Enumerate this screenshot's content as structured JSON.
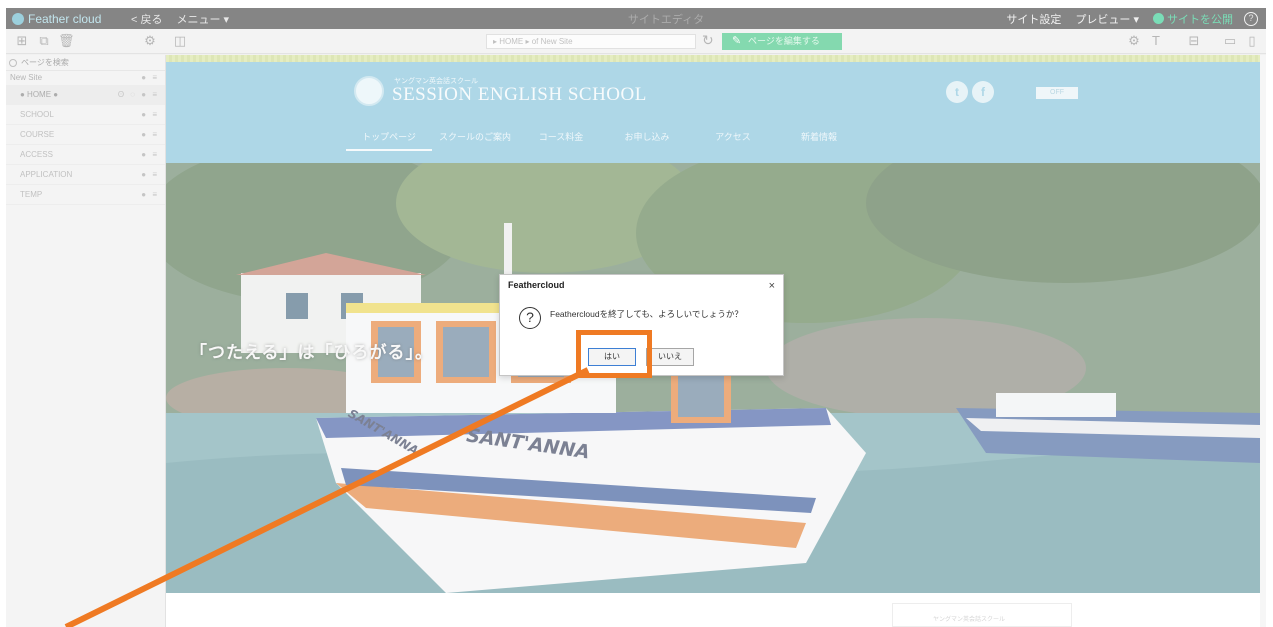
{
  "topbar": {
    "brand": "Feather cloud",
    "back": "< 戻る",
    "menu": "メニュー ▾",
    "center_title": "サイトエディタ",
    "site_settings": "サイト設定",
    "preview": "プレビュー ▾",
    "publish": "サイトを公開",
    "help": "?"
  },
  "toolbar": {
    "url": "▸ HOME ▸ of New Site",
    "edit_page": "ページを編集する"
  },
  "sidebar": {
    "search_placeholder": "ページを検索",
    "root": "New Site",
    "pages": [
      {
        "label": "● HOME ●",
        "icons": "ʘ ◌ ● ≡"
      },
      {
        "label": "SCHOOL",
        "icons": "● ≡"
      },
      {
        "label": "COURSE",
        "icons": "● ≡"
      },
      {
        "label": "ACCESS",
        "icons": "● ≡"
      },
      {
        "label": "APPLICATION",
        "icons": "● ≡"
      },
      {
        "label": "TEMP",
        "icons": "● ≡"
      }
    ]
  },
  "site": {
    "logo_small": "ヤングマン英会話スクール",
    "logo_main": "SESSION ENGLISH SCHOOL",
    "twitter": "t",
    "facebook": "f",
    "off_button": "OFF",
    "nav": [
      "トップページ",
      "スクールのご案内",
      "コース料金",
      "お申し込み",
      "アクセス",
      "新着情報"
    ],
    "tagline": "「つたえる」は「ひろがる」。",
    "boat_name_1": "SANT'ANNA",
    "boat_name_2": "SANT'ANNA",
    "footer_card": "ヤングマン英会話スクール"
  },
  "dialog": {
    "title": "Feathercloud",
    "close": "×",
    "icon": "?",
    "message": "Feathercloudを終了しても、よろしいでしょうか？",
    "yes": "はい",
    "no": "いいえ"
  },
  "colors": {
    "annotation": "#ef7a23",
    "header": "#7dbfd9",
    "edit_button": "#39c27e"
  }
}
